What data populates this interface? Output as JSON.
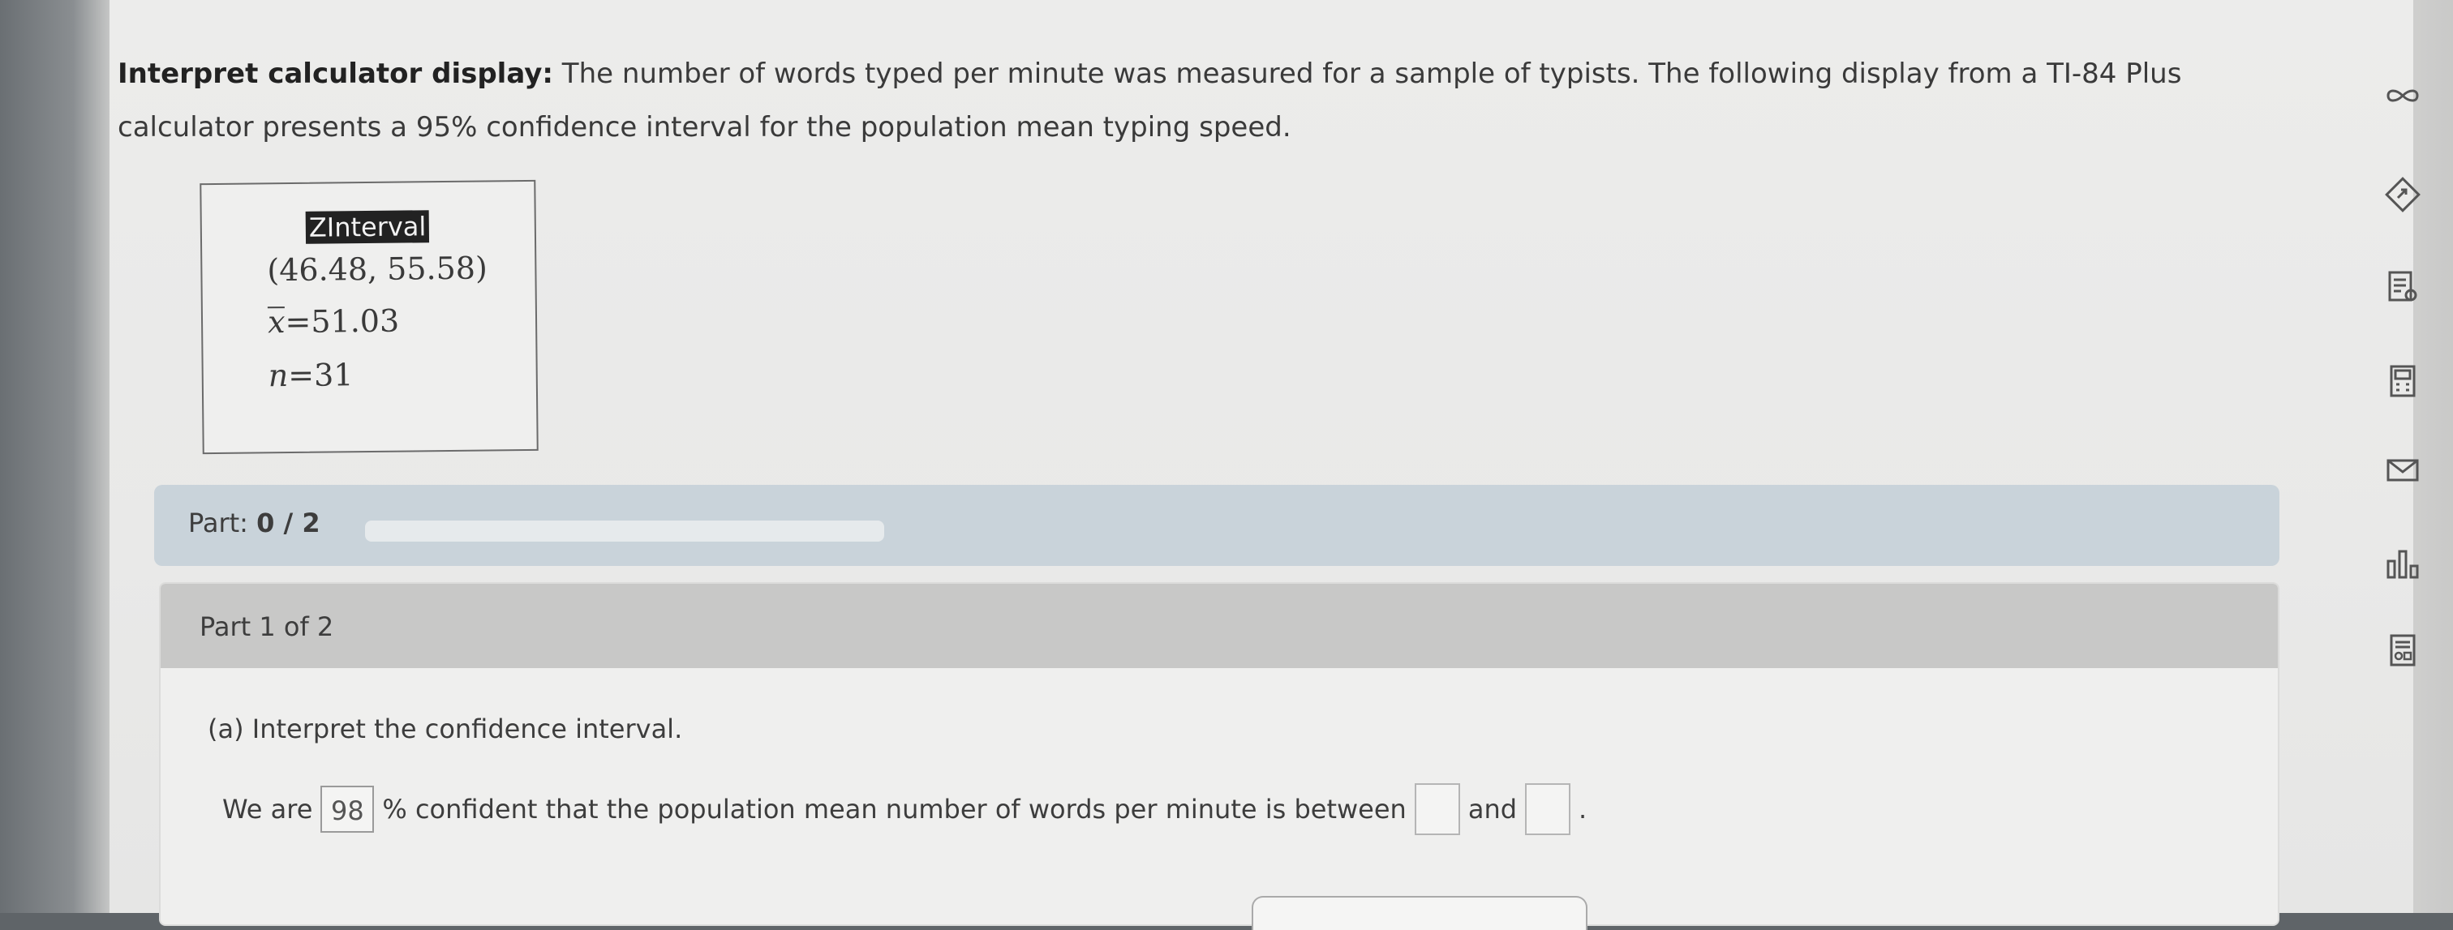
{
  "problem": {
    "lead": "Interpret calculator display:",
    "text": " The number of words typed per minute was measured for a sample of typists. The following display from a TI-84 Plus calculator presents a 95% confidence interval for the population mean typing speed."
  },
  "calculator": {
    "title": "ZInterval",
    "interval": "(46.48, 55.58)",
    "xbar_symbol": "x",
    "xbar_value": "=51.03",
    "n_symbol": "n",
    "n_value": "=31"
  },
  "progress": {
    "label_prefix": "Part: ",
    "current": "0",
    "separator": " / ",
    "total": "2",
    "fraction_complete": 0
  },
  "part": {
    "header": "Part 1 of 2",
    "question": "(a) Interpret the confidence interval.",
    "answer_prefix": "We are",
    "confidence_value": "98",
    "answer_middle": "% confident that the population mean number of words per minute is between",
    "and_text": "and",
    "lower_value": "",
    "upper_value": "",
    "end_text": "."
  },
  "sidebar": {
    "icons": [
      "infinity-icon",
      "tutorial-icon",
      "textbook-icon",
      "calculator-icon",
      "message-icon",
      "chart-icon",
      "data-icon"
    ]
  }
}
